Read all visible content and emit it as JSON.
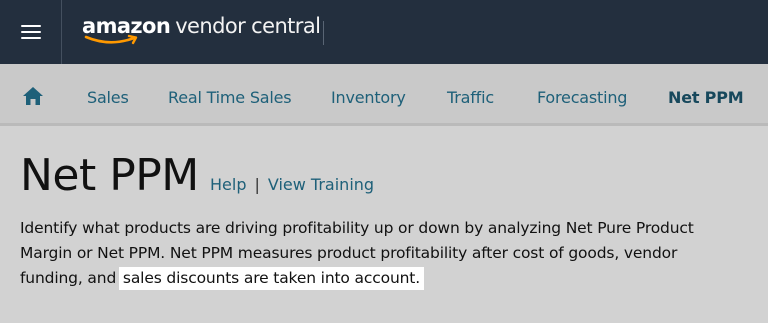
{
  "header": {
    "brand": "amazon",
    "product": "vendor central"
  },
  "nav": {
    "items": [
      {
        "label": "Sales"
      },
      {
        "label": "Real Time Sales"
      },
      {
        "label": "Inventory"
      },
      {
        "label": "Traffic"
      },
      {
        "label": "Forecasting"
      },
      {
        "label": "Net PPM"
      }
    ],
    "active": "Net PPM"
  },
  "main": {
    "title": "Net PPM",
    "help_label": "Help",
    "separator": "|",
    "training_label": "View Training",
    "description": {
      "line1": "Identify what products are driving profitability up or down by analyzing Net Pure Product",
      "line2": "Margin or Net PPM. Net PPM measures product profitability after cost of goods, vendor",
      "line3_plain": "funding, and ",
      "line3_highlight": "sales discounts are taken into account."
    }
  },
  "colors": {
    "header_bg": "#232f3e",
    "nav_bg": "#c9c9c9",
    "page_bg": "#d2d2d2",
    "link": "#1e6079",
    "smile": "#ff9900"
  },
  "icons": {
    "menu": "hamburger-menu-icon",
    "home": "home-icon"
  }
}
